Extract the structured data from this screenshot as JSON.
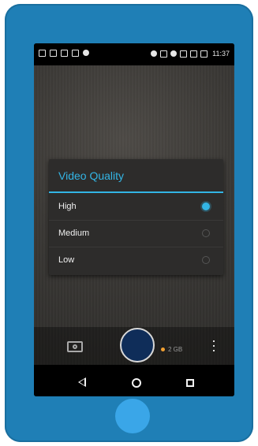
{
  "status_bar": {
    "time": "11:37"
  },
  "dialog": {
    "title": "Video Quality",
    "options": [
      {
        "label": "High",
        "selected": true
      },
      {
        "label": "Medium",
        "selected": false
      },
      {
        "label": "Low",
        "selected": false
      }
    ]
  },
  "controls": {
    "storage": "2 GB"
  },
  "colors": {
    "accent": "#33b5e5",
    "phone_body": "#1f7fb6",
    "home_button": "#3aa6e8",
    "shutter_fill": "#0f2d59"
  },
  "icons": {
    "camera_mode": "camera-icon",
    "overflow": "overflow-menu-icon",
    "nav_back": "back-icon",
    "nav_home": "home-icon",
    "nav_recents": "recents-icon"
  }
}
